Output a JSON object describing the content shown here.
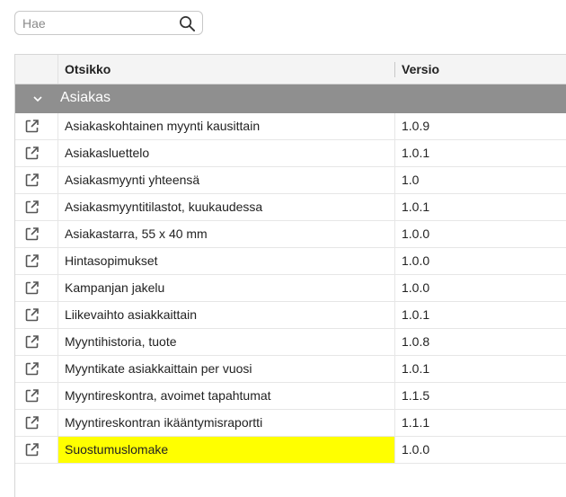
{
  "search": {
    "placeholder": "Hae",
    "value": ""
  },
  "table": {
    "columns": {
      "title": "Otsikko",
      "version": "Versio"
    },
    "group": {
      "label": "Asiakas"
    },
    "rows": [
      {
        "title": "Asiakaskohtainen myynti kausittain",
        "version": "1.0.9"
      },
      {
        "title": "Asiakasluettelo",
        "version": "1.0.1"
      },
      {
        "title": "Asiakasmyynti yhteensä",
        "version": "1.0"
      },
      {
        "title": "Asiakasmyyntitilastot, kuukaudessa",
        "version": "1.0.1"
      },
      {
        "title": "Asiakastarra, 55 x 40 mm",
        "version": "1.0.0"
      },
      {
        "title": "Hintasopimukset",
        "version": "1.0.0"
      },
      {
        "title": "Kampanjan jakelu",
        "version": "1.0.0"
      },
      {
        "title": "Liikevaihto asiakkaittain",
        "version": "1.0.1"
      },
      {
        "title": "Myyntihistoria, tuote",
        "version": "1.0.8"
      },
      {
        "title": "Myyntikate asiakkaittain per vuosi",
        "version": "1.0.1"
      },
      {
        "title": "Myyntireskontra, avoimet tapahtumat",
        "version": "1.1.5"
      },
      {
        "title": "Myyntireskontran ikääntymisraportti",
        "version": "1.1.1"
      },
      {
        "title": "Suostumuslomake",
        "version": "1.0.0",
        "highlighted": true
      }
    ]
  },
  "colors": {
    "group_bg": "#8f8f8f",
    "highlight": "#ffff00",
    "header_bg": "#f4f4f4"
  },
  "icons": {
    "search": "search-icon",
    "open": "open-external-icon",
    "collapse": "chevron-down-icon"
  }
}
